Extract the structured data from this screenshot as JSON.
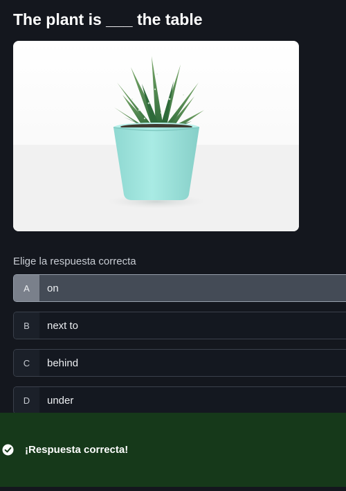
{
  "question": {
    "title": "The plant is ___ the table"
  },
  "image": {
    "icon": "potted-succulent-photo"
  },
  "prompt": "Elige la respuesta correcta",
  "options": [
    {
      "key": "A",
      "label": "on",
      "selected": true
    },
    {
      "key": "B",
      "label": "next to",
      "selected": false
    },
    {
      "key": "C",
      "label": "behind",
      "selected": false
    },
    {
      "key": "D",
      "label": "under",
      "selected": false
    }
  ],
  "feedback": {
    "text": "¡Respuesta correcta!",
    "icon": "check-circle-icon",
    "color": "#16391a"
  },
  "colors": {
    "background": "#14171e",
    "selected_option": "#444b56",
    "pot": "#9ee3dc"
  }
}
